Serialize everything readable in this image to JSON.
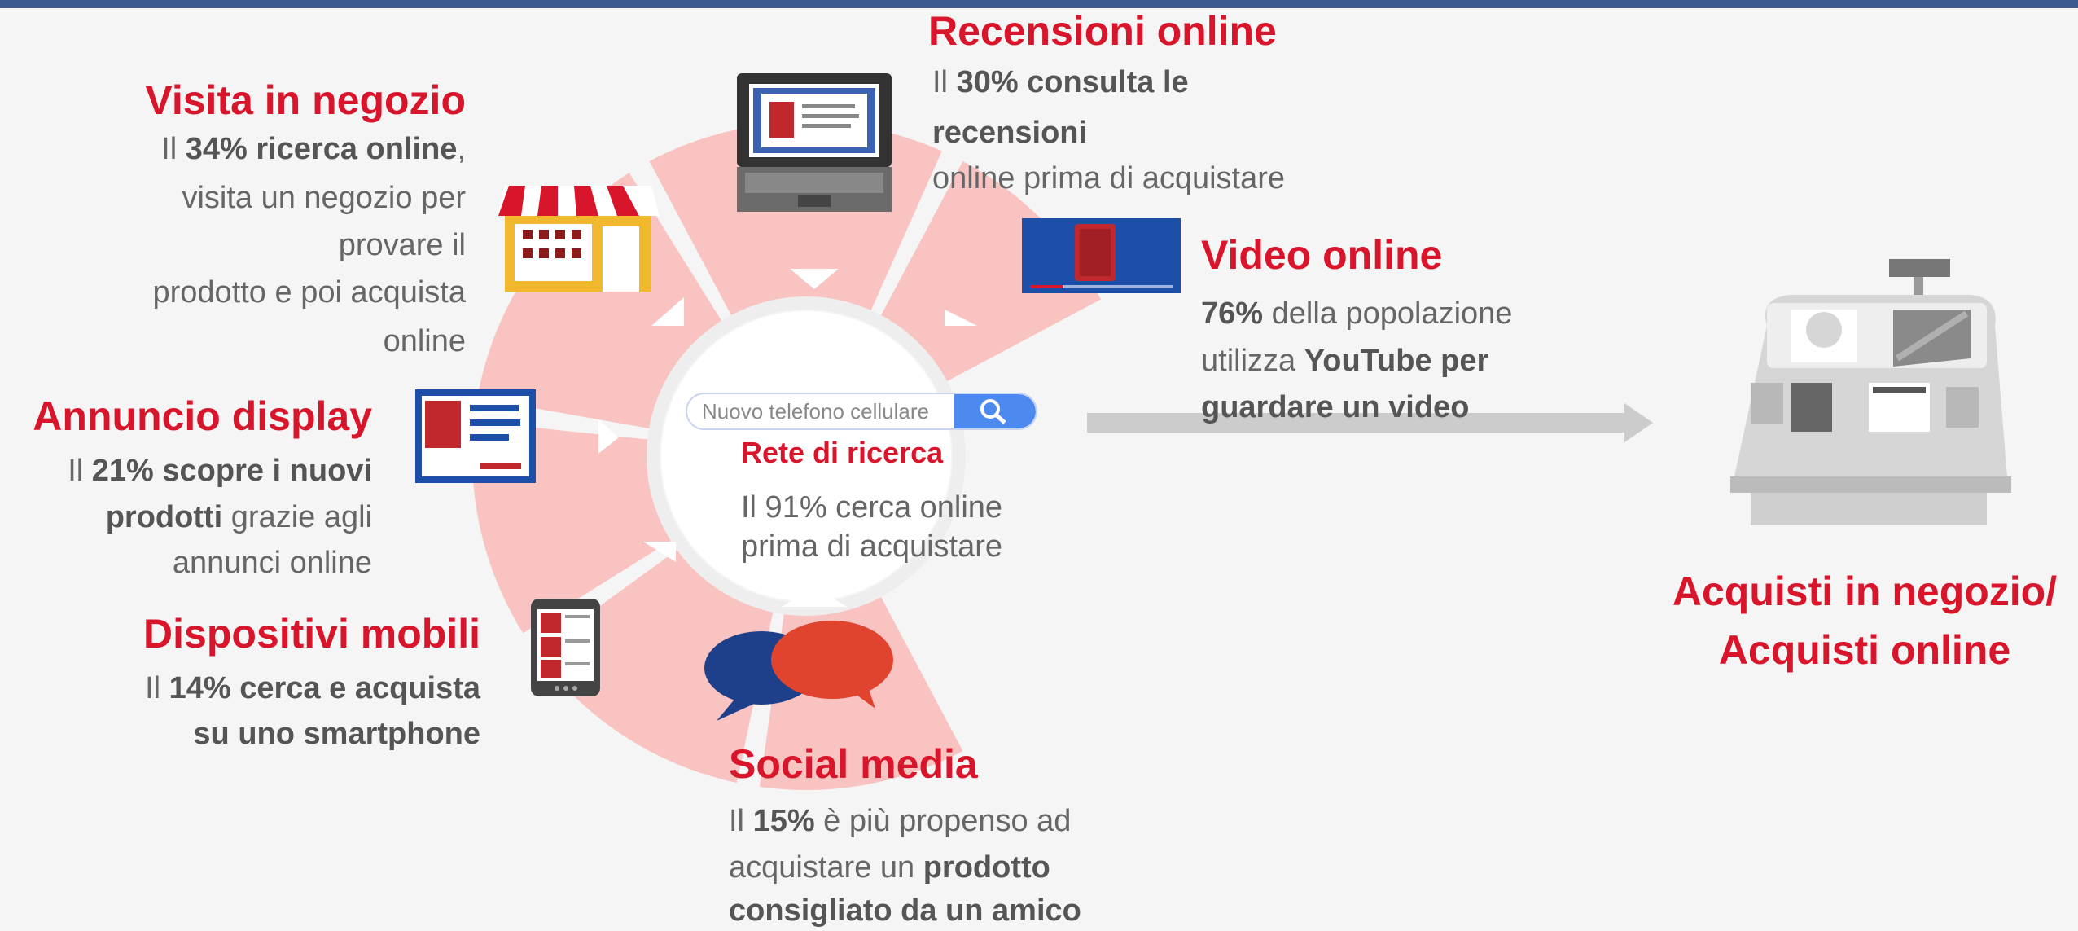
{
  "accent_color": "#d9152b",
  "ring_color": "#f8c3c0",
  "center": {
    "search_placeholder": "Nuovo telefono cellulare",
    "title": "Rete di ricerca",
    "line1": "Il 91% cerca online",
    "line2": "prima di acquistare"
  },
  "recensioni": {
    "title": "Recensioni online",
    "l1_pre": "Il ",
    "l1_bold": "30% consulta le",
    "l2_bold": "recensioni",
    "l3": "online prima di acquistare"
  },
  "visita": {
    "title": "Visita in negozio",
    "l1_pre": "Il ",
    "l1_bold": "34% ricerca online",
    "l1_post": ",",
    "l2": "visita un negozio per",
    "l3": "provare il",
    "l4": "prodotto e poi acquista",
    "l5": "online"
  },
  "video": {
    "title": "Video online",
    "l1_bold": "76%",
    "l1_post": " della popolazione",
    "l2_pre": "utilizza ",
    "l2_bold": "YouTube per",
    "l3_bold": "guardare un video"
  },
  "annuncio": {
    "title": "Annuncio display",
    "l1_pre": "Il ",
    "l1_bold": "21% scopre i nuovi",
    "l2_bold": "prodotti",
    "l2_post": " grazie agli",
    "l3": "annunci online"
  },
  "dispositivi": {
    "title": "Dispositivi mobili",
    "l1_pre": "Il ",
    "l1_bold": "14% cerca e acquista",
    "l2_bold": "su uno smartphone"
  },
  "social": {
    "title": "Social media",
    "l1_pre": "Il ",
    "l1_bold": "15%",
    "l1_post": " è più propenso ad",
    "l2_pre": "acquistare un ",
    "l2_bold": "prodotto",
    "l3_bold": "consigliato da un amico"
  },
  "acquisti": {
    "line1": "Acquisti in negozio/",
    "line2": "Acquisti online"
  },
  "icons": [
    "laptop-icon",
    "store-icon",
    "video-icon",
    "display-ad-icon",
    "smartphone-icon",
    "chat-bubbles-icon",
    "search-icon",
    "cash-register-icon",
    "arrow-right-icon"
  ]
}
